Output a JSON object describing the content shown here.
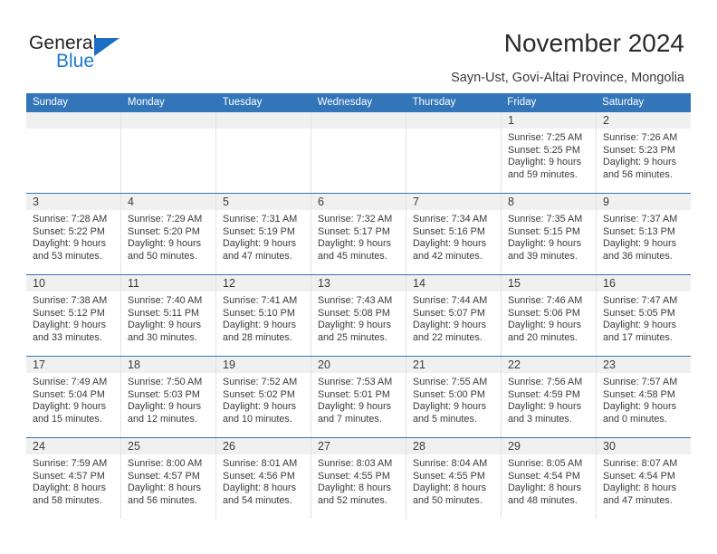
{
  "brand": {
    "name_dark": "General",
    "name_blue": "Blue",
    "accent_color": "#1b7ad1",
    "header_color": "#3275b8"
  },
  "header": {
    "title": "November 2024",
    "subtitle": "Sayn-Ust, Govi-Altai Province, Mongolia"
  },
  "calendar": {
    "weekday_headers": [
      "Sunday",
      "Monday",
      "Tuesday",
      "Wednesday",
      "Thursday",
      "Friday",
      "Saturday"
    ],
    "weeks": [
      [
        {
          "day": "",
          "sunrise": "",
          "sunset": "",
          "daylight_line1": "",
          "daylight_line2": ""
        },
        {
          "day": "",
          "sunrise": "",
          "sunset": "",
          "daylight_line1": "",
          "daylight_line2": ""
        },
        {
          "day": "",
          "sunrise": "",
          "sunset": "",
          "daylight_line1": "",
          "daylight_line2": ""
        },
        {
          "day": "",
          "sunrise": "",
          "sunset": "",
          "daylight_line1": "",
          "daylight_line2": ""
        },
        {
          "day": "",
          "sunrise": "",
          "sunset": "",
          "daylight_line1": "",
          "daylight_line2": ""
        },
        {
          "day": "1",
          "sunrise": "Sunrise: 7:25 AM",
          "sunset": "Sunset: 5:25 PM",
          "daylight_line1": "Daylight: 9 hours",
          "daylight_line2": "and 59 minutes."
        },
        {
          "day": "2",
          "sunrise": "Sunrise: 7:26 AM",
          "sunset": "Sunset: 5:23 PM",
          "daylight_line1": "Daylight: 9 hours",
          "daylight_line2": "and 56 minutes."
        }
      ],
      [
        {
          "day": "3",
          "sunrise": "Sunrise: 7:28 AM",
          "sunset": "Sunset: 5:22 PM",
          "daylight_line1": "Daylight: 9 hours",
          "daylight_line2": "and 53 minutes."
        },
        {
          "day": "4",
          "sunrise": "Sunrise: 7:29 AM",
          "sunset": "Sunset: 5:20 PM",
          "daylight_line1": "Daylight: 9 hours",
          "daylight_line2": "and 50 minutes."
        },
        {
          "day": "5",
          "sunrise": "Sunrise: 7:31 AM",
          "sunset": "Sunset: 5:19 PM",
          "daylight_line1": "Daylight: 9 hours",
          "daylight_line2": "and 47 minutes."
        },
        {
          "day": "6",
          "sunrise": "Sunrise: 7:32 AM",
          "sunset": "Sunset: 5:17 PM",
          "daylight_line1": "Daylight: 9 hours",
          "daylight_line2": "and 45 minutes."
        },
        {
          "day": "7",
          "sunrise": "Sunrise: 7:34 AM",
          "sunset": "Sunset: 5:16 PM",
          "daylight_line1": "Daylight: 9 hours",
          "daylight_line2": "and 42 minutes."
        },
        {
          "day": "8",
          "sunrise": "Sunrise: 7:35 AM",
          "sunset": "Sunset: 5:15 PM",
          "daylight_line1": "Daylight: 9 hours",
          "daylight_line2": "and 39 minutes."
        },
        {
          "day": "9",
          "sunrise": "Sunrise: 7:37 AM",
          "sunset": "Sunset: 5:13 PM",
          "daylight_line1": "Daylight: 9 hours",
          "daylight_line2": "and 36 minutes."
        }
      ],
      [
        {
          "day": "10",
          "sunrise": "Sunrise: 7:38 AM",
          "sunset": "Sunset: 5:12 PM",
          "daylight_line1": "Daylight: 9 hours",
          "daylight_line2": "and 33 minutes."
        },
        {
          "day": "11",
          "sunrise": "Sunrise: 7:40 AM",
          "sunset": "Sunset: 5:11 PM",
          "daylight_line1": "Daylight: 9 hours",
          "daylight_line2": "and 30 minutes."
        },
        {
          "day": "12",
          "sunrise": "Sunrise: 7:41 AM",
          "sunset": "Sunset: 5:10 PM",
          "daylight_line1": "Daylight: 9 hours",
          "daylight_line2": "and 28 minutes."
        },
        {
          "day": "13",
          "sunrise": "Sunrise: 7:43 AM",
          "sunset": "Sunset: 5:08 PM",
          "daylight_line1": "Daylight: 9 hours",
          "daylight_line2": "and 25 minutes."
        },
        {
          "day": "14",
          "sunrise": "Sunrise: 7:44 AM",
          "sunset": "Sunset: 5:07 PM",
          "daylight_line1": "Daylight: 9 hours",
          "daylight_line2": "and 22 minutes."
        },
        {
          "day": "15",
          "sunrise": "Sunrise: 7:46 AM",
          "sunset": "Sunset: 5:06 PM",
          "daylight_line1": "Daylight: 9 hours",
          "daylight_line2": "and 20 minutes."
        },
        {
          "day": "16",
          "sunrise": "Sunrise: 7:47 AM",
          "sunset": "Sunset: 5:05 PM",
          "daylight_line1": "Daylight: 9 hours",
          "daylight_line2": "and 17 minutes."
        }
      ],
      [
        {
          "day": "17",
          "sunrise": "Sunrise: 7:49 AM",
          "sunset": "Sunset: 5:04 PM",
          "daylight_line1": "Daylight: 9 hours",
          "daylight_line2": "and 15 minutes."
        },
        {
          "day": "18",
          "sunrise": "Sunrise: 7:50 AM",
          "sunset": "Sunset: 5:03 PM",
          "daylight_line1": "Daylight: 9 hours",
          "daylight_line2": "and 12 minutes."
        },
        {
          "day": "19",
          "sunrise": "Sunrise: 7:52 AM",
          "sunset": "Sunset: 5:02 PM",
          "daylight_line1": "Daylight: 9 hours",
          "daylight_line2": "and 10 minutes."
        },
        {
          "day": "20",
          "sunrise": "Sunrise: 7:53 AM",
          "sunset": "Sunset: 5:01 PM",
          "daylight_line1": "Daylight: 9 hours",
          "daylight_line2": "and 7 minutes."
        },
        {
          "day": "21",
          "sunrise": "Sunrise: 7:55 AM",
          "sunset": "Sunset: 5:00 PM",
          "daylight_line1": "Daylight: 9 hours",
          "daylight_line2": "and 5 minutes."
        },
        {
          "day": "22",
          "sunrise": "Sunrise: 7:56 AM",
          "sunset": "Sunset: 4:59 PM",
          "daylight_line1": "Daylight: 9 hours",
          "daylight_line2": "and 3 minutes."
        },
        {
          "day": "23",
          "sunrise": "Sunrise: 7:57 AM",
          "sunset": "Sunset: 4:58 PM",
          "daylight_line1": "Daylight: 9 hours",
          "daylight_line2": "and 0 minutes."
        }
      ],
      [
        {
          "day": "24",
          "sunrise": "Sunrise: 7:59 AM",
          "sunset": "Sunset: 4:57 PM",
          "daylight_line1": "Daylight: 8 hours",
          "daylight_line2": "and 58 minutes."
        },
        {
          "day": "25",
          "sunrise": "Sunrise: 8:00 AM",
          "sunset": "Sunset: 4:57 PM",
          "daylight_line1": "Daylight: 8 hours",
          "daylight_line2": "and 56 minutes."
        },
        {
          "day": "26",
          "sunrise": "Sunrise: 8:01 AM",
          "sunset": "Sunset: 4:56 PM",
          "daylight_line1": "Daylight: 8 hours",
          "daylight_line2": "and 54 minutes."
        },
        {
          "day": "27",
          "sunrise": "Sunrise: 8:03 AM",
          "sunset": "Sunset: 4:55 PM",
          "daylight_line1": "Daylight: 8 hours",
          "daylight_line2": "and 52 minutes."
        },
        {
          "day": "28",
          "sunrise": "Sunrise: 8:04 AM",
          "sunset": "Sunset: 4:55 PM",
          "daylight_line1": "Daylight: 8 hours",
          "daylight_line2": "and 50 minutes."
        },
        {
          "day": "29",
          "sunrise": "Sunrise: 8:05 AM",
          "sunset": "Sunset: 4:54 PM",
          "daylight_line1": "Daylight: 8 hours",
          "daylight_line2": "and 48 minutes."
        },
        {
          "day": "30",
          "sunrise": "Sunrise: 8:07 AM",
          "sunset": "Sunset: 4:54 PM",
          "daylight_line1": "Daylight: 8 hours",
          "daylight_line2": "and 47 minutes."
        }
      ]
    ]
  }
}
